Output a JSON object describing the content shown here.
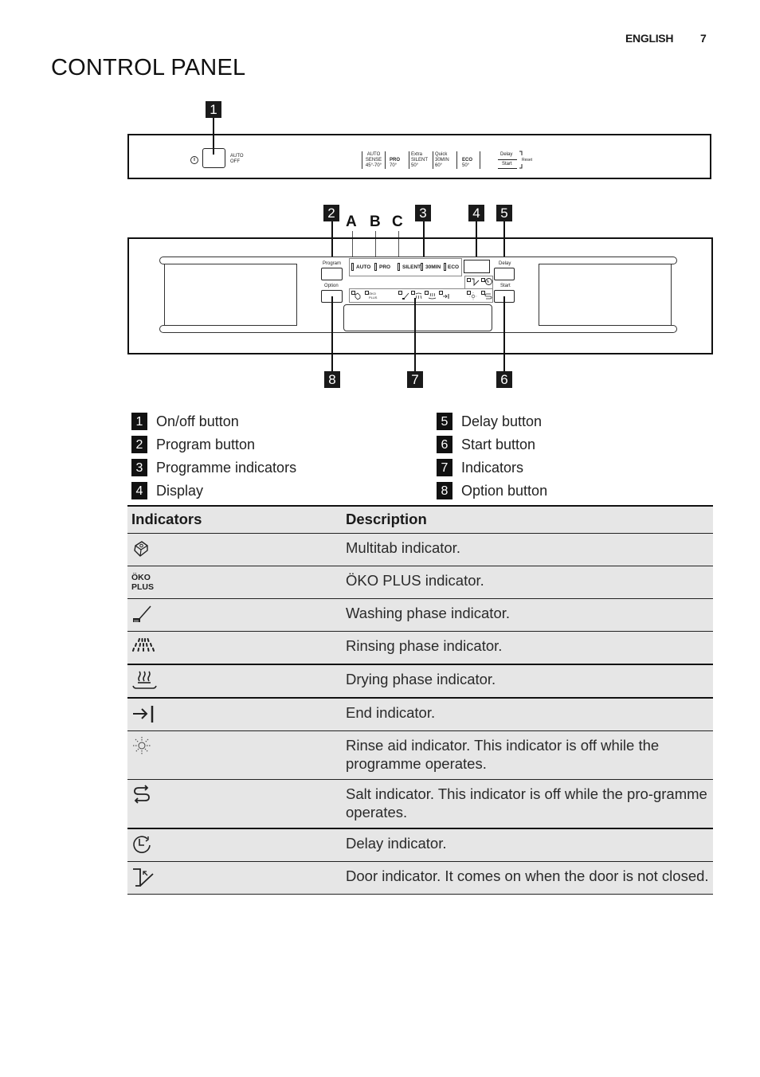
{
  "header": {
    "language": "ENGLISH",
    "page_number": "7"
  },
  "page_title": "CONTROL PANEL",
  "panel_top": {
    "callout": "1",
    "power_symbol": "power-icon",
    "auto_off_label": [
      "AUTO",
      "OFF"
    ],
    "programmes": [
      {
        "lines": [
          "AUTO",
          "SENSE",
          "45°-70°"
        ]
      },
      {
        "lines": [
          "PRO",
          "70°"
        ]
      },
      {
        "lines": [
          "Extra",
          "SILENT",
          "50°"
        ]
      },
      {
        "lines": [
          "Quick",
          "30MIN",
          "60°"
        ]
      },
      {
        "lines": [
          "ECO",
          "50°"
        ]
      }
    ],
    "delay_label": "Delay",
    "start_label": "Start",
    "reset_label": "Reset"
  },
  "panel_bottom": {
    "callouts_top": [
      "2",
      "3",
      "4",
      "5"
    ],
    "callouts_bottom": [
      "8",
      "7",
      "6"
    ],
    "letters": [
      "A",
      "B",
      "C"
    ],
    "program_label": "Program",
    "option_label": "Option",
    "delay_label": "Delay",
    "start_label": "Start",
    "programme_indicators": [
      "AUTO",
      "PRO",
      "SILENT",
      "30MIN",
      "ECO"
    ],
    "oko_plus_label": [
      "ÖKO",
      "PLUS"
    ]
  },
  "legend": [
    {
      "num": "1",
      "label": "On/off button"
    },
    {
      "num": "2",
      "label": "Program button"
    },
    {
      "num": "3",
      "label": "Programme indicators"
    },
    {
      "num": "4",
      "label": "Display"
    },
    {
      "num": "5",
      "label": "Delay button"
    },
    {
      "num": "6",
      "label": "Start button"
    },
    {
      "num": "7",
      "label": "Indicators"
    },
    {
      "num": "8",
      "label": "Option button"
    }
  ],
  "table": {
    "headers": [
      "Indicators",
      "Description"
    ],
    "rows": [
      {
        "icon": "multitab-icon",
        "description": "Multitab indicator."
      },
      {
        "icon": "oko-plus-icon",
        "icon_text": [
          "ÖKO",
          "PLUS"
        ],
        "description": "ÖKO PLUS indicator."
      },
      {
        "icon": "washing-phase-icon",
        "description": "Washing phase indicator."
      },
      {
        "icon": "rinsing-phase-icon",
        "description": "Rinsing phase indicator."
      },
      {
        "icon": "drying-phase-icon",
        "description": "Drying phase indicator."
      },
      {
        "icon": "end-icon",
        "description": "End indicator."
      },
      {
        "icon": "rinse-aid-icon",
        "description": "Rinse aid indicator. This indicator is off while the programme operates."
      },
      {
        "icon": "salt-icon",
        "description": "Salt indicator. This indicator is off while the pro-gramme operates."
      },
      {
        "icon": "delay-icon",
        "description": "Delay indicator."
      },
      {
        "icon": "door-icon",
        "description": "Door indicator. It comes on when the door is not closed."
      }
    ]
  }
}
